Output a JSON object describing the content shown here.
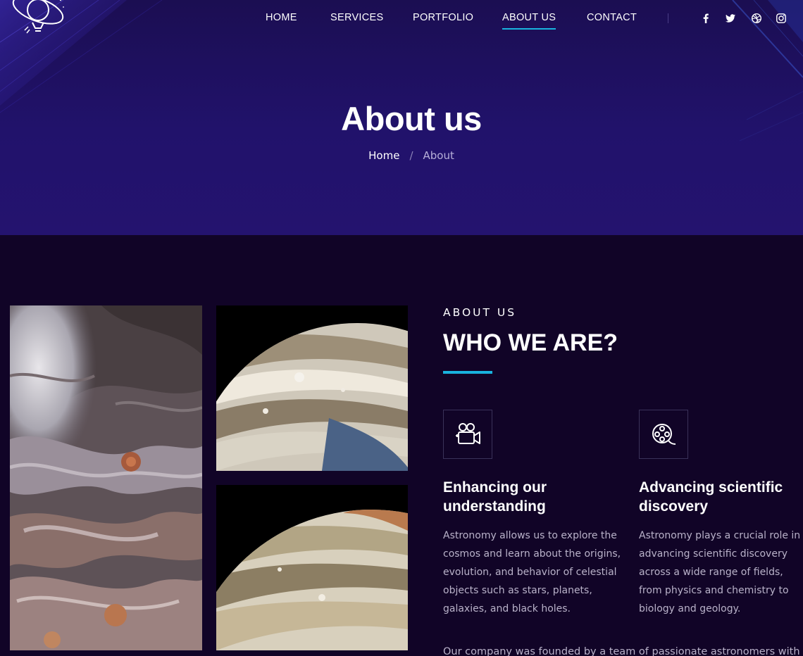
{
  "nav": {
    "items": [
      {
        "label": "HOME"
      },
      {
        "label": "SERVICES"
      },
      {
        "label": "PORTFOLIO"
      },
      {
        "label": "ABOUT US",
        "active": true
      },
      {
        "label": "CONTACT"
      }
    ],
    "social": [
      "facebook-icon",
      "twitter-icon",
      "dribbble-icon",
      "instagram-icon"
    ]
  },
  "hero": {
    "title": "About us",
    "breadcrumb": {
      "home": "Home",
      "separator": "/",
      "current": "About"
    }
  },
  "about": {
    "eyebrow": "ABOUT US",
    "title": "WHO WE ARE?",
    "features": [
      {
        "icon": "video-camera-icon",
        "title": "Enhancing our understanding",
        "text": "Astronomy allows us to explore the cosmos and learn about the origins, evolution, and behavior of celestial objects such as stars, planets, galaxies, and black holes."
      },
      {
        "icon": "film-reel-icon",
        "title": "Advancing scientific discovery",
        "text": "Astronomy plays a crucial role in advancing scientific discovery across a wide range of fields, from physics and chemistry to biology and geology."
      }
    ],
    "paragraph": "Our company was founded by a team of passionate astronomers with a"
  },
  "colors": {
    "accent": "#19b3de",
    "hero_bg": "#21126b",
    "page_bg": "#110427",
    "body_text": "#b9b2c9"
  }
}
